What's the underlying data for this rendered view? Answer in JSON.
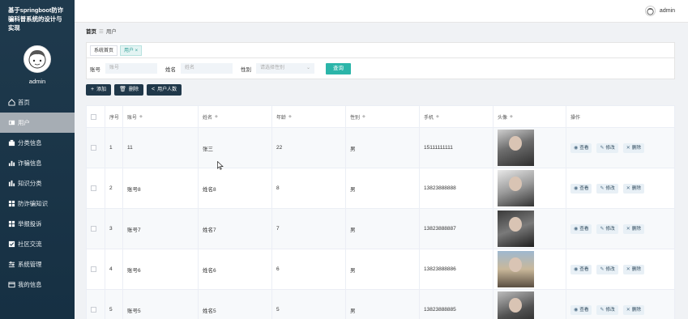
{
  "app": {
    "title": "基于springboot防诈骗科普系统的设计与实现",
    "username": "admin"
  },
  "sidebar": {
    "items": [
      {
        "label": "首页",
        "icon": "home-icon"
      },
      {
        "label": "用户",
        "icon": "users-icon",
        "active": true
      },
      {
        "label": "分类信息",
        "icon": "category-icon"
      },
      {
        "label": "诈骗信息",
        "icon": "chart-icon"
      },
      {
        "label": "知识分类",
        "icon": "chart-icon"
      },
      {
        "label": "防诈骗知识",
        "icon": "grid-icon"
      },
      {
        "label": "举报投诉",
        "icon": "grid-icon"
      },
      {
        "label": "社区交流",
        "icon": "check-icon"
      },
      {
        "label": "系统管理",
        "icon": "settings-icon"
      },
      {
        "label": "我的信息",
        "icon": "card-icon"
      }
    ]
  },
  "topbar": {
    "username": "admin"
  },
  "breadcrumb": {
    "home": "首页",
    "current": "用户"
  },
  "tabs": [
    {
      "label": "系统首页"
    },
    {
      "label": "用户 ×",
      "active": true
    }
  ],
  "search": {
    "account_label": "账号",
    "account_placeholder": "账号",
    "name_label": "姓名",
    "name_placeholder": "姓名",
    "gender_label": "性别",
    "gender_placeholder": "请选择性别",
    "query_button": "查询"
  },
  "actions": {
    "add": "添加",
    "delete": "删除",
    "stats": "用户人数"
  },
  "table": {
    "headers": {
      "index": "序号",
      "account": "账号",
      "name": "姓名",
      "age": "年龄",
      "gender": "性别",
      "phone": "手机",
      "avatar": "头像",
      "ops": "操作"
    },
    "rows": [
      {
        "index": "1",
        "account": "11",
        "name": "张三",
        "age": "22",
        "gender": "男",
        "phone": "15111111111"
      },
      {
        "index": "2",
        "account": "账号8",
        "name": "姓名8",
        "age": "8",
        "gender": "男",
        "phone": "13823888888"
      },
      {
        "index": "3",
        "account": "账号7",
        "name": "姓名7",
        "age": "7",
        "gender": "男",
        "phone": "13823888887"
      },
      {
        "index": "4",
        "account": "账号6",
        "name": "姓名6",
        "age": "6",
        "gender": "男",
        "phone": "13823888886"
      },
      {
        "index": "5",
        "account": "账号5",
        "name": "姓名5",
        "age": "5",
        "gender": "男",
        "phone": "13823888885"
      }
    ],
    "ops": {
      "view": "查看",
      "edit": "修改",
      "delete": "删除"
    }
  },
  "colors": {
    "sidebar": "#1f3a4d",
    "accent": "#2bb5a9",
    "dark_button": "#20384a"
  }
}
